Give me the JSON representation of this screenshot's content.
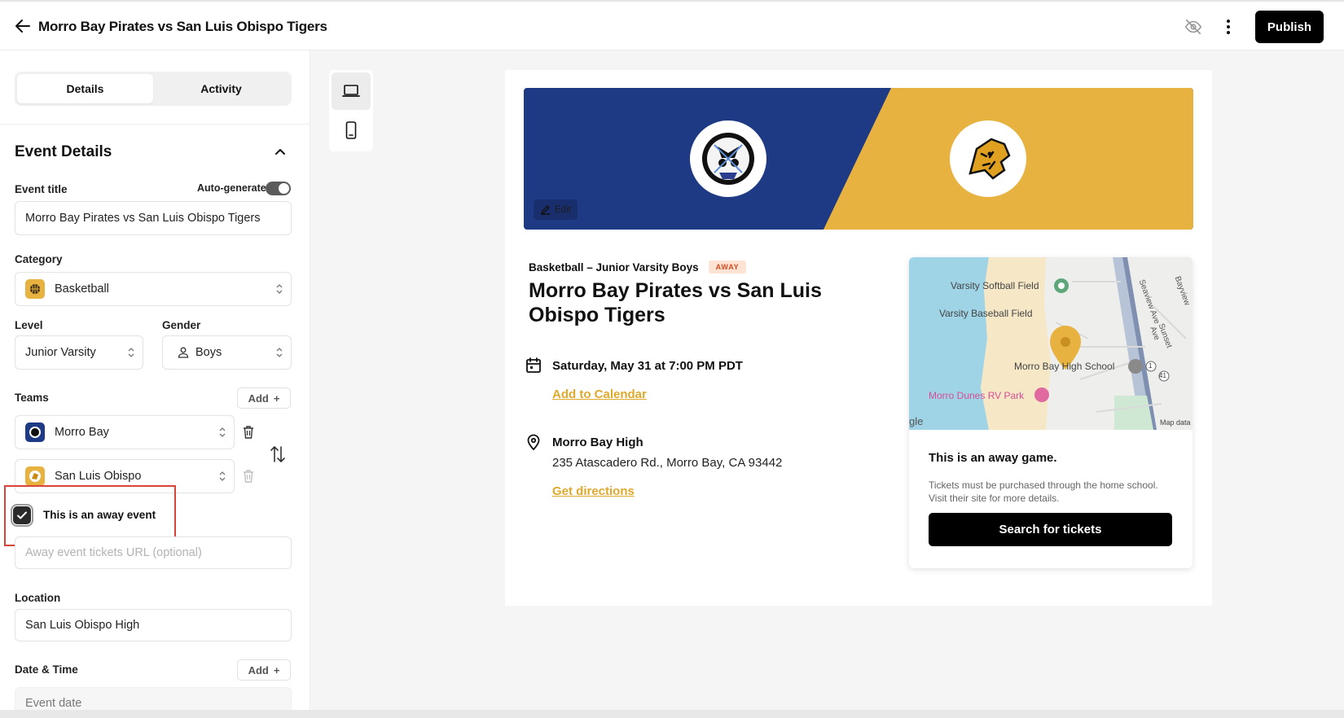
{
  "header": {
    "title": "Morro Bay Pirates vs San Luis Obispo Tigers",
    "publish_label": "Publish"
  },
  "sidebar": {
    "tabs": [
      {
        "label": "Details",
        "active": true
      },
      {
        "label": "Activity",
        "active": false
      }
    ],
    "section_title": "Event Details",
    "event_title_label": "Event title",
    "auto_generate_label": "Auto-generate",
    "auto_generate_on": true,
    "event_title_value": "Morro Bay Pirates vs San Luis Obispo Tigers",
    "category_label": "Category",
    "category_value": "Basketball",
    "level_label": "Level",
    "level_value": "Junior Varsity",
    "gender_label": "Gender",
    "gender_value": "Boys",
    "teams_label": "Teams",
    "add_label": "Add",
    "teams": [
      "Morro Bay",
      "San Luis Obispo"
    ],
    "away_checkbox_label": "This is an away event",
    "away_checked": true,
    "away_url_placeholder": "Away event tickets URL (optional)",
    "location_label": "Location",
    "location_value": "San Luis Obispo High",
    "datetime_label": "Date & Time",
    "event_date_placeholder": "Event date"
  },
  "preview": {
    "edit_label": "Edit",
    "meta_line": "Basketball – Junior Varsity Boys",
    "away_badge": "AWAY",
    "event_title": "Morro Bay Pirates vs San Luis Obispo Tigers",
    "datetime": "Saturday, May 31 at 7:00 PM PDT",
    "add_to_calendar": "Add to Calendar",
    "venue_name": "Morro Bay High",
    "venue_address": "235 Atascadero Rd., Morro Bay, CA 93442",
    "get_directions": "Get directions",
    "map_labels": {
      "softball": "Varsity Softball Field",
      "baseball": "Varsity Baseball Field",
      "school": "Morro Bay High School",
      "rv_park": "Morro Dunes RV Park",
      "seaview": "Seaview Ave",
      "sunset": "Sunset Ave",
      "bayview": "Bayview",
      "google": "gle",
      "map_data": "Map data",
      "route1": "1",
      "route41": "41"
    },
    "away_game_title": "This is an away game.",
    "away_game_desc": "Tickets must be purchased through the home school. Visit their site for more details.",
    "search_tickets": "Search for tickets"
  },
  "colors": {
    "home_blue": "#1f3a85",
    "away_gold": "#e8b240",
    "link_gold": "#e0a82c",
    "highlight_red": "#d9443a"
  }
}
